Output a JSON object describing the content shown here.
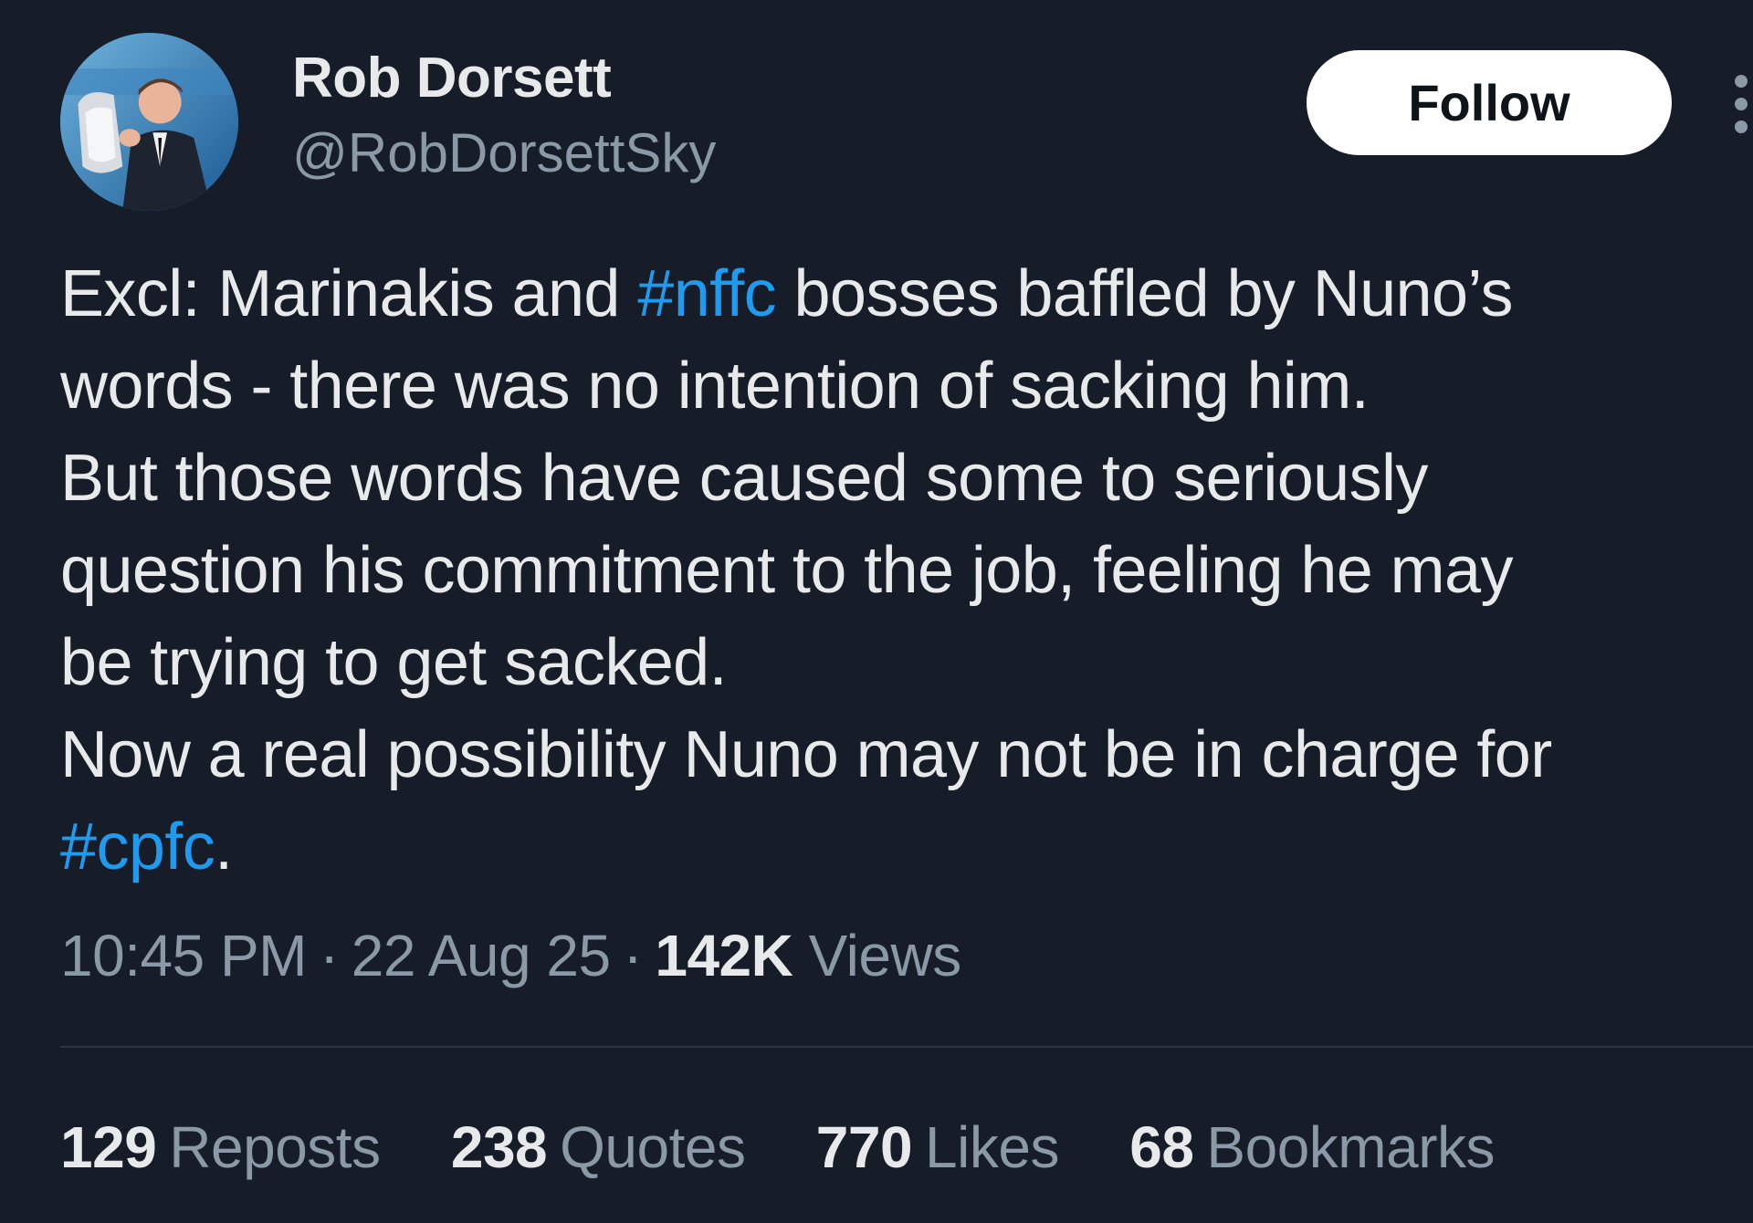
{
  "author": {
    "name": "Rob Dorsett",
    "handle": "@RobDorsettSky"
  },
  "follow_button": {
    "label": "Follow"
  },
  "tweet": {
    "lines": [
      [
        {
          "text": "Excl: Marinakis and "
        },
        {
          "text": "#nffc",
          "hashtag": true
        },
        {
          "text": " bosses baffled by Nuno’s"
        }
      ],
      [
        {
          "text": "words - there was no intention of sacking him."
        }
      ],
      [
        {
          "text": "But those words have caused some to seriously"
        }
      ],
      [
        {
          "text": "question his commitment to the job, feeling he may"
        }
      ],
      [
        {
          "text": "be trying to get sacked."
        }
      ],
      [
        {
          "text": "Now a real possibility Nuno may not be in charge for"
        }
      ],
      [
        {
          "text": "#cpfc",
          "hashtag": true
        },
        {
          "text": "."
        }
      ]
    ]
  },
  "meta": {
    "time": "10:45 PM",
    "separator": "·",
    "date": "22 Aug 25",
    "views_count": "142K",
    "views_label": "Views"
  },
  "stats": [
    {
      "count": "129",
      "label": "Reposts"
    },
    {
      "count": "238",
      "label": "Quotes"
    },
    {
      "count": "770",
      "label": "Likes"
    },
    {
      "count": "68",
      "label": "Bookmarks"
    }
  ],
  "colors": {
    "background": "#161d28",
    "text": "#e7e9ea",
    "muted": "#8b98a5",
    "hashtag": "#1d9bf0",
    "follow_bg": "#ffffff"
  }
}
